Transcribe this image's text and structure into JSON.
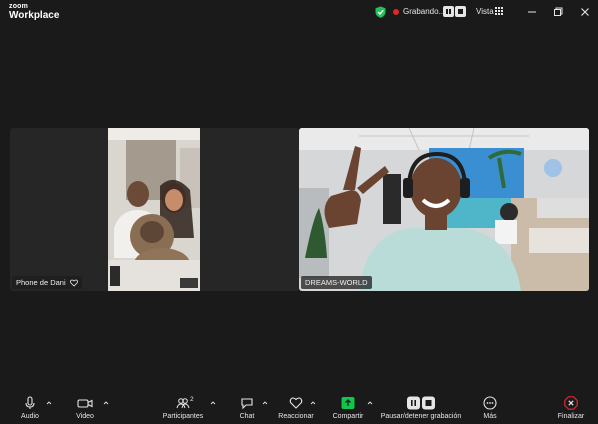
{
  "brand": {
    "line1": "zoom",
    "line2": "Workplace"
  },
  "titlebar": {
    "recording_label": "Grabando...",
    "view_label": "Vista"
  },
  "tiles": [
    {
      "name": "Phone de Dani",
      "favorite_icon": "heart-icon"
    },
    {
      "name": "DREAMS-WORLD"
    }
  ],
  "toolbar": {
    "audio": "Audio",
    "video": "Video",
    "participants": "Participantes",
    "participants_count": "2",
    "chat": "Chat",
    "react": "Reaccionar",
    "share": "Compartir",
    "recording": "Pausar/detener grabación",
    "more": "Más",
    "end": "Finalizar"
  },
  "colors": {
    "background": "#1a1a1a",
    "tile_background": "#262626",
    "share_green": "#0ec84b",
    "recording_red": "#e02828",
    "shield_green": "#23c05c",
    "end_red": "#e0282e"
  }
}
